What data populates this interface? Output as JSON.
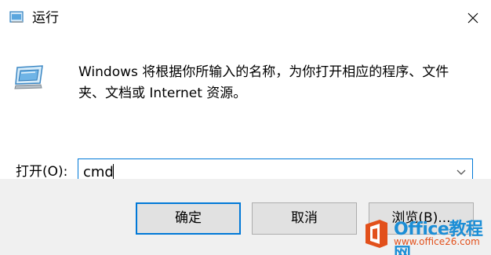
{
  "window": {
    "title": "运行",
    "close_icon": "close-icon",
    "run_icon": "run-dialog-icon"
  },
  "content": {
    "description": "Windows 将根据你所输入的名称，为你打开相应的程序、文件夹、文档或 Internet 资源。",
    "open_label": "打开(O):",
    "open_value": "cmd"
  },
  "buttons": {
    "ok": "确定",
    "cancel": "取消",
    "browse": "浏览(B)..."
  },
  "watermark": {
    "text": "Office教程网",
    "sub": "www.office26.com"
  },
  "colors": {
    "accent": "#0078d7",
    "footer_bg": "#f0f0f0",
    "button_bg": "#e1e1e1"
  }
}
